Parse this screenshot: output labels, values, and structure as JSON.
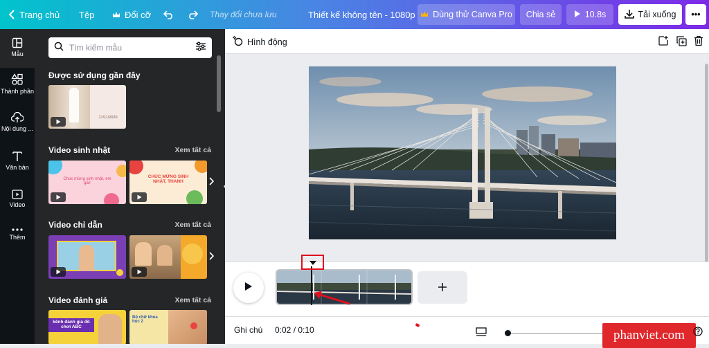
{
  "topbar": {
    "home_label": "Trang chủ",
    "file_label": "Tệp",
    "resize_label": "Đổi cỡ",
    "unsaved_status": "Thay đổi chưa lưu",
    "design_title": "Thiết kế không tên - 1080p",
    "try_pro_label": "Dùng thử Canva Pro",
    "share_label": "Chia sẻ",
    "play_duration": "10.8s",
    "download_label": "Tải xuống",
    "more_label": "•••"
  },
  "rail": {
    "items": [
      {
        "label": "Mẫu",
        "icon": "template-icon"
      },
      {
        "label": "Thành phần",
        "icon": "elements-icon"
      },
      {
        "label": "Nội dung ...",
        "icon": "upload-icon"
      },
      {
        "label": "Văn bản",
        "icon": "text-icon"
      },
      {
        "label": "Video",
        "icon": "video-icon"
      },
      {
        "label": "Thêm",
        "icon": "more-icon"
      }
    ]
  },
  "panel": {
    "search_placeholder": "Tìm kiếm mẫu",
    "sections": [
      {
        "title": "Được sử dụng gần đây",
        "see_all": ""
      },
      {
        "title": "Video sinh nhật",
        "see_all": "Xem tất cả"
      },
      {
        "title": "Video chỉ dẫn",
        "see_all": "Xem tất cả"
      },
      {
        "title": "Video đánh giá",
        "see_all": "Xem tất cả"
      }
    ],
    "thumb_texts": {
      "recent_date": "17/11/2020",
      "bday1": "Chúc mừng sinh nhật, em gái!",
      "bday2": "CHÚC MỪNG SINH NHẬT, THANH",
      "review1": "kênh đánh giá đồ chơi ABC",
      "review2": "Bộ chữ khoa học 2"
    }
  },
  "editor": {
    "animation_label": "Hình động",
    "notes_label": "Ghi chú",
    "time_label": "0:02 / 0:10",
    "watermark": "phanviet.com"
  },
  "colors": {
    "accent_red": "#e0101c",
    "panel_bg": "#252627",
    "rail_bg": "#0e1318"
  }
}
